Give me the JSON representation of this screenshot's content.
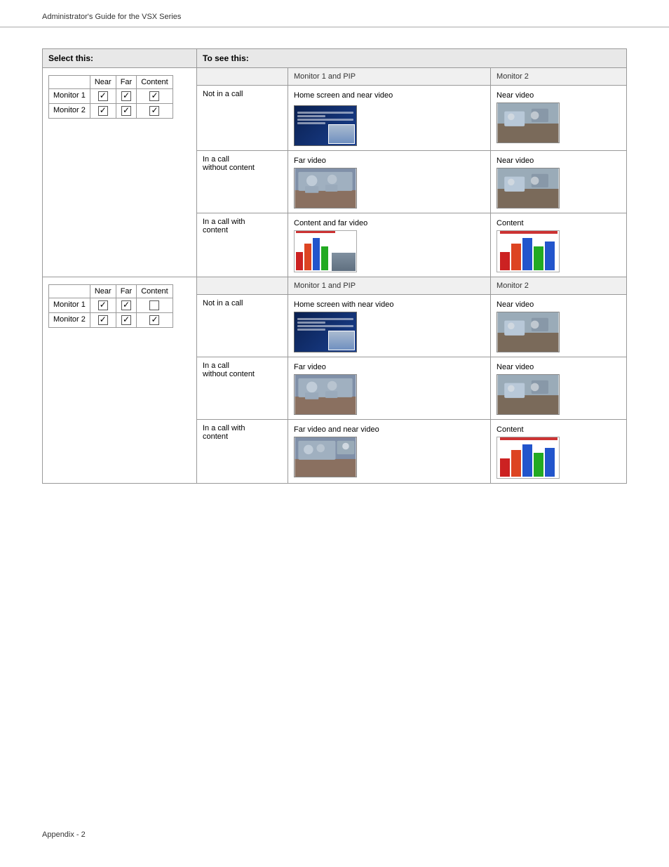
{
  "header": {
    "title": "Administrator's Guide for the VSX Series"
  },
  "footer": {
    "label": "Appendix - 2"
  },
  "table": {
    "col1_header": "Select this:",
    "col2_header": "To see this:",
    "monitor1pip": "Monitor 1 and PIP",
    "monitor2": "Monitor 2",
    "near_label": "Near",
    "far_label": "Far",
    "content_label": "Content",
    "monitor1_label": "Monitor 1",
    "monitor2_label": "Monitor 2",
    "sections": [
      {
        "checkboxes": {
          "m1_near": true,
          "m1_far": true,
          "m1_content": true,
          "m2_near": true,
          "m2_far": true,
          "m2_content": true
        },
        "rows": [
          {
            "scenario": "Not in a call",
            "col1_label": "Home screen and near video",
            "col2_label": "Near video"
          },
          {
            "scenario": "In a call without content",
            "col1_label": "Far video",
            "col2_label": "Near video"
          },
          {
            "scenario": "In a call with content",
            "col1_label": "Content and far video",
            "col2_label": "Content"
          }
        ]
      },
      {
        "checkboxes": {
          "m1_near": true,
          "m1_far": true,
          "m1_content": false,
          "m2_near": true,
          "m2_far": true,
          "m2_content": true
        },
        "rows": [
          {
            "scenario": "Not in a call",
            "col1_label": "Home screen with near video",
            "col2_label": "Near video"
          },
          {
            "scenario": "In a call without content",
            "col1_label": "Far video",
            "col2_label": "Near video"
          },
          {
            "scenario": "In a call with content",
            "col1_label": "Far video and near video",
            "col2_label": "Content"
          }
        ]
      }
    ]
  }
}
